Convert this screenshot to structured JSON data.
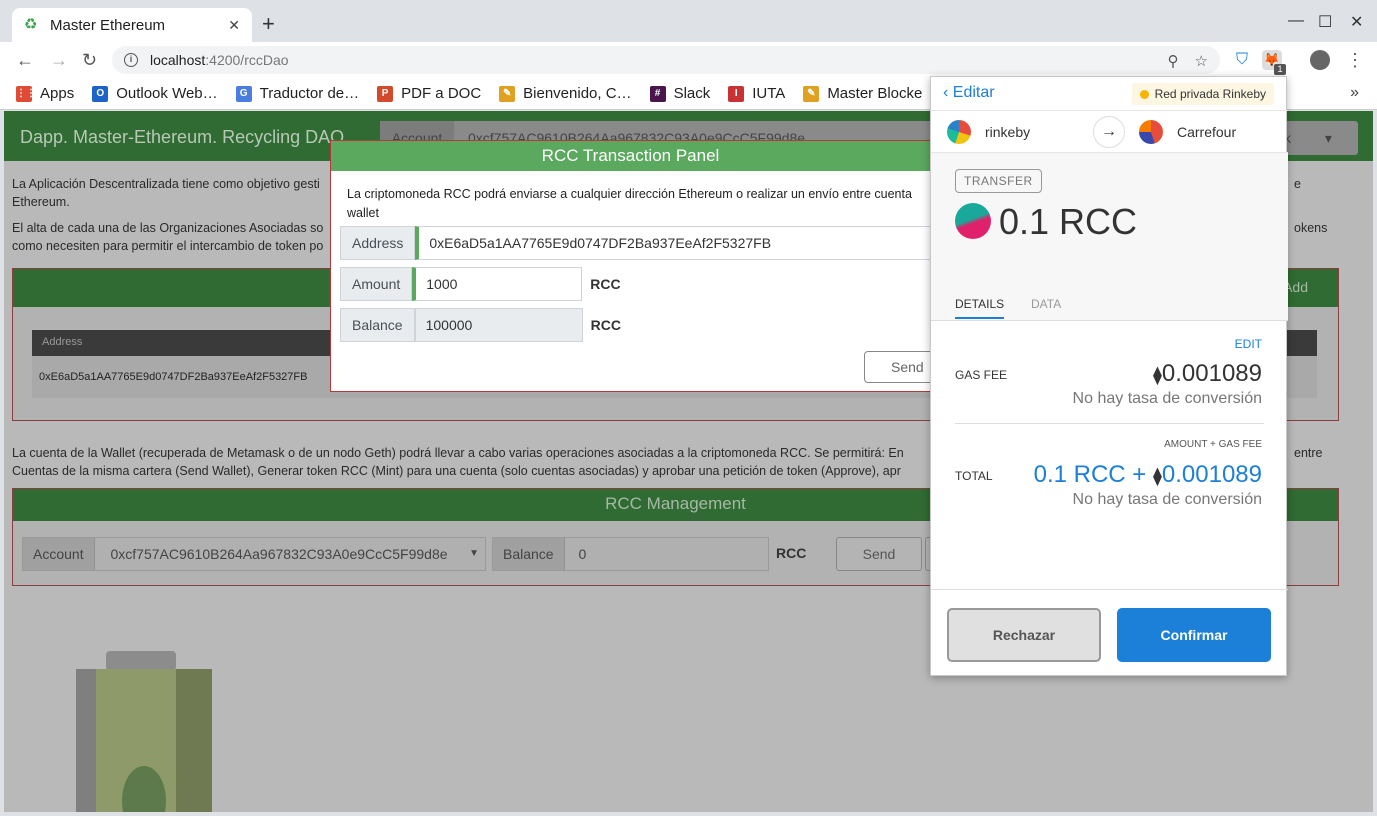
{
  "browser": {
    "tab_title": "Master Ethereum",
    "url_host": "localhost",
    "url_path": ":4200/rccDao",
    "ext_badge": "1"
  },
  "bookmarks": [
    {
      "label": "Apps",
      "color": "#e04b35"
    },
    {
      "label": "Outlook Web…",
      "color": "#1e64c8"
    },
    {
      "label": "Traductor de…",
      "color": "#4a7de0"
    },
    {
      "label": "PDF a DOC",
      "color": "#d24a2a"
    },
    {
      "label": "Bienvenido, C…",
      "color": "#e0a020"
    },
    {
      "label": "Slack",
      "color": "#4a154b"
    },
    {
      "label": "IUTA",
      "color": "#c83232"
    },
    {
      "label": "Master Blocke",
      "color": "#e0a020"
    }
  ],
  "app": {
    "title": "Dapp. Master-Ethereum. Recycling DAO",
    "account_label": "Account",
    "account_value": "0xcf757AC9610B264Aa967832C93A0e9CcC5F99d8e",
    "network_label": "k",
    "intro_1a": "La Aplicación Descentralizada tiene como objetivo gesti",
    "intro_1b": "e",
    "intro_1c": "Ethereum.",
    "intro_2a": "El alta de cada una de las Organizaciones Asociadas so",
    "intro_2b": "okens",
    "intro_2c": "como necesiten para permitir el intercambio de token po",
    "orgs_add": "Add",
    "orgs_col_address": "Address",
    "orgs_row_address": "0xE6aD5a1AA7765E9d0747DF2Ba937EeAf2F5327FB",
    "wallet_text_1a": "La cuenta de la Wallet (recuperada de Metamask o de un nodo Geth) podrá llevar a cabo varias operaciones asociadas a la criptomoneda RCC. Se permitirá: En",
    "wallet_text_1b": "entre",
    "wallet_text_2": "Cuentas de la misma cartera (Send Wallet), Generar token RCC (Mint) para una cuenta (solo cuentas asociadas) y aprobar una petición de token (Approve), apr",
    "mgmt_title": "RCC Management",
    "mgmt_account_label": "Account",
    "mgmt_account_value": "0xcf757AC9610B264Aa967832C93A0e9CcC5F99d8e",
    "mgmt_balance_label": "Balance",
    "mgmt_balance_value": "0",
    "mgmt_unit": "RCC",
    "mgmt_send": "Send"
  },
  "modal": {
    "title": "RCC Transaction Panel",
    "desc": "La criptomoneda RCC podrá enviarse a cualquier dirección Ethereum o realizar un envío entre cuenta",
    "desc2": "wallet",
    "address_label": "Address",
    "address_value": "0xE6aD5a1AA7765E9d0747DF2Ba937EeAf2F5327FB",
    "amount_label": "Amount",
    "amount_value": "1000",
    "amount_unit": "RCC",
    "balance_label": "Balance",
    "balance_value": "100000",
    "balance_unit": "RCC",
    "send": "Send"
  },
  "metamask": {
    "back": "Editar",
    "network": "Red privada Rinkeby",
    "from": "rinkeby",
    "to": "Carrefour",
    "badge": "TRANSFER",
    "amount": "0.1 RCC",
    "tab_details": "DETAILS",
    "tab_data": "DATA",
    "edit": "EDIT",
    "gas_label": "GAS FEE",
    "gas_value": "0.001089",
    "no_conv": "No hay tasa de conversión",
    "amount_gas_label": "AMOUNT + GAS FEE",
    "total_label": "TOTAL",
    "total_value_a": "0.1 RCC +",
    "total_value_b": "0.001089",
    "no_conv_2": "No hay tasa de conversión",
    "reject": "Rechazar",
    "confirm": "Confirmar"
  }
}
